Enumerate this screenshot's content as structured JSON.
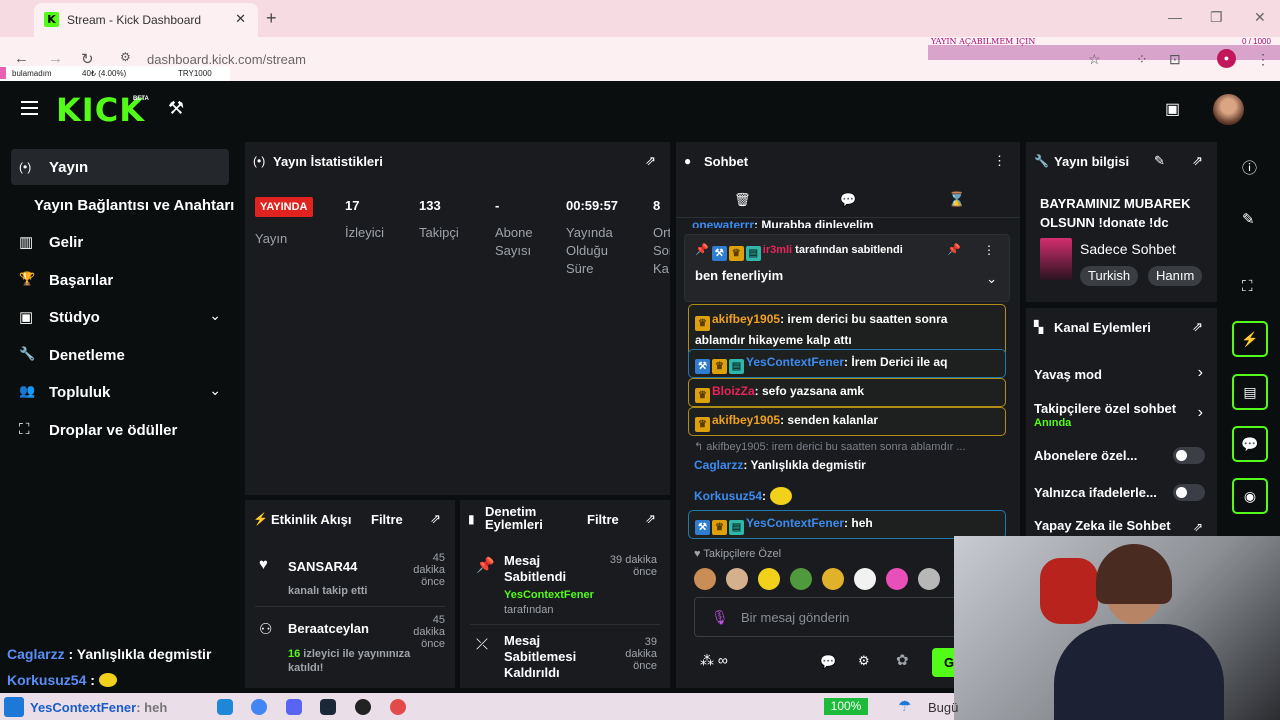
{
  "browser": {
    "tab_title": "Stream - Kick Dashboard",
    "tab_close": "✕",
    "new_tab": "+",
    "url": "dashboard.kick.com/stream",
    "overlay_title": "YAYIN AÇABILMEM IÇIN",
    "overlay_count": "0 / 1000",
    "mini": {
      "left": "bulamadım",
      "mid": "40₺ (4.00%)",
      "right": "TRY1000"
    }
  },
  "header": {
    "logo": "KICK",
    "beta": "BETA"
  },
  "sidebar": {
    "items": [
      {
        "label": "Yayın",
        "icon": "(•)"
      },
      {
        "label": "Gelir",
        "icon": "▥"
      },
      {
        "label": "Başarılar",
        "icon": "🏆"
      },
      {
        "label": "Stüdyo",
        "icon": "▣"
      },
      {
        "label": "Denetleme",
        "icon": "🔧"
      },
      {
        "label": "Topluluk",
        "icon": "👥"
      },
      {
        "label": "Droplar ve ödüller",
        "icon": "⛶"
      }
    ],
    "sub_item": "Yayın Bağlantısı ve Anahtarı"
  },
  "overlay_chat": [
    {
      "user": "Caglarzz",
      "sep": " : ",
      "text": "Yanlışlıkla degmistir"
    },
    {
      "user": "Korkusuz54",
      "sep": " : ",
      "text": ""
    }
  ],
  "stats": {
    "title": "Yayın İstatistikleri",
    "live": "YAYINDA",
    "live_label": "Yayın",
    "columns": [
      {
        "value": "17",
        "label": "İzleyici"
      },
      {
        "value": "133",
        "label": "Takipçi"
      },
      {
        "value": "-",
        "label": "Abone Sayısı"
      },
      {
        "value": "00:59:57",
        "label": "Yayında Olduğu Süre"
      },
      {
        "value": "8",
        "label": "Ort Son Ka"
      }
    ]
  },
  "activity": {
    "title": "Etkinlik Akışı",
    "filter": "Filtre",
    "events": [
      {
        "user": "SANSAR44",
        "desc": "kanalı takip etti",
        "time": "45 dakika önce"
      },
      {
        "user": "Beraatceylan",
        "count": "16",
        "desc": " izleyici ile yayınınıza katıldı!",
        "time": "45 dakika önce"
      }
    ]
  },
  "moderation": {
    "title": "Denetim Eylemleri",
    "filter": "Filtre",
    "actions": [
      {
        "title": "Mesaj Sabitlendi",
        "by_user": "YesContextFener",
        "by_text": "tarafından",
        "time": "39 dakika önce"
      },
      {
        "title": "Mesaj Sabitlemesi Kaldırıldı",
        "time": "39 dakika önce"
      }
    ]
  },
  "chat": {
    "title": "Sohbet",
    "cut_user": "onewaterrr",
    "cut_text": ": Murabba dinleyelim",
    "pinned_by_user": "ir3mli",
    "pinned_by_text": " tarafından sabitlendi",
    "pinned_text": "ben fenerliyim",
    "messages": [
      {
        "user": "akifbey1905",
        "color": "#f0a020",
        "text": ": irem derici bu saatten sonra ablamdır hikayeme kalp attı",
        "style": "gold"
      },
      {
        "user": "YesContextFener",
        "color": "#3b8cf0",
        "text": ": İrem Derici ile aq",
        "style": "blue"
      },
      {
        "user": "BloizZa",
        "color": "#e8245a",
        "text": ": sefo yazsana amk",
        "style": "gold"
      },
      {
        "user": "akifbey1905",
        "color": "#f0a020",
        "text": ": senden kalanlar",
        "style": "gold"
      }
    ],
    "reply_ref": "↰ akifbey1905: irem derici bu saatten sonra ablamdır ...",
    "plain": [
      {
        "user": "Caglarzz",
        "text": ": Yanlışlıkla degmistir"
      },
      {
        "user": "Korkusuz54",
        "text": ":"
      }
    ],
    "last": {
      "user": "YesContextFener",
      "text": ": heh"
    },
    "followers_only": "Takipçilere Özel",
    "input_placeholder": "Bir mesaj gönderin",
    "send": "G"
  },
  "stream_info": {
    "title": "Yayın bilgisi",
    "stream_title": "BAYRAMINIZ MUBAREK OLSUNN !donate !dc",
    "category": "Sadece Sohbet",
    "tags": [
      "Turkish",
      "Hanım"
    ]
  },
  "channel_actions": {
    "title": "Kanal Eylemleri",
    "rows": [
      {
        "label": "Yavaş mod"
      },
      {
        "label": "Takipçilere özel sohbet",
        "sub": "Anında"
      },
      {
        "label": "Abonelere özel..."
      },
      {
        "label": "Yalnızca ifadelerle..."
      },
      {
        "label": "Yapay Zeka ile Sohbet Denetimi"
      }
    ]
  },
  "taskbar": {
    "overlay_user": "YesContextFener",
    "overlay_text": ": heh",
    "battery": "100%",
    "weather": "Bugü"
  },
  "colors": {
    "kick_green": "#53fc18",
    "live_red": "#e1231f",
    "panel": "#191b1f",
    "bg": "#0b0e0f"
  }
}
